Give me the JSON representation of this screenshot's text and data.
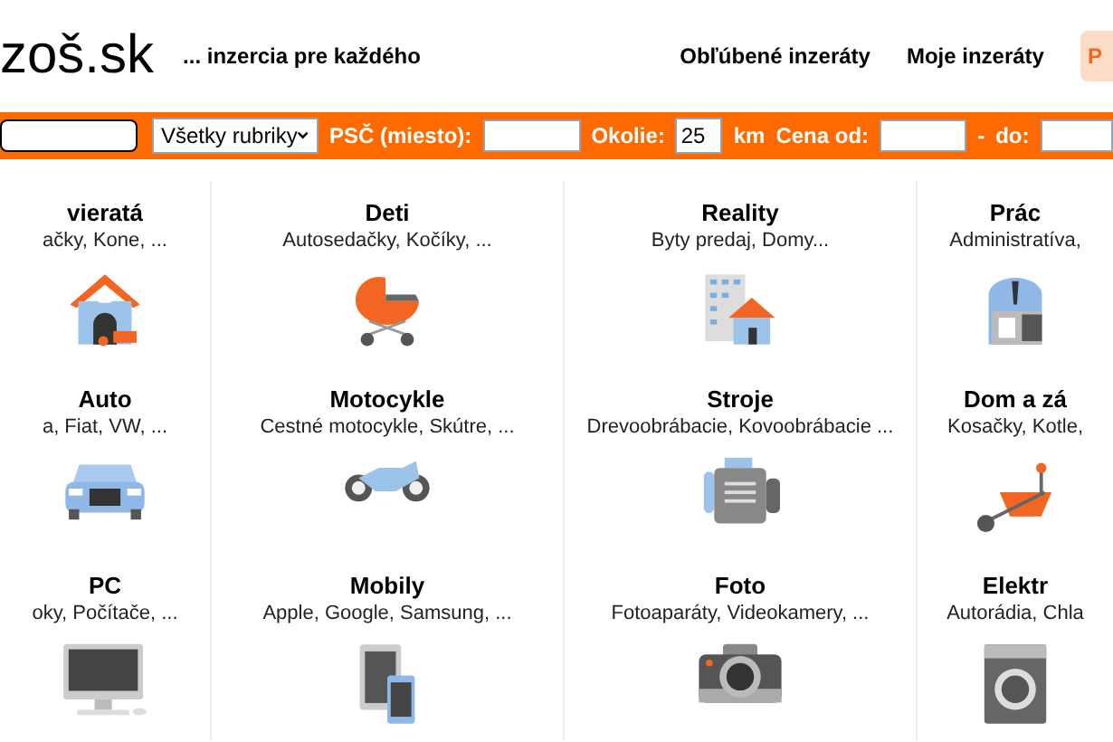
{
  "header": {
    "logo": "zoš.sk",
    "tagline": "... inzercia pre každého",
    "links": [
      "Obľúbené inzeráty",
      "Moje inzeráty"
    ],
    "button": "P"
  },
  "search_bar": {
    "category_select": "Všetky rubriky",
    "zip_label": "PSČ (miesto):",
    "radius_label": "Okolie:",
    "radius_value": "25",
    "radius_unit": "km",
    "price_from_label": "Cena od:",
    "price_separator": "-",
    "price_to_label": "do:"
  },
  "categories": [
    {
      "title": "vieratá",
      "subtitle": "ačky, Kone, ...",
      "kind": "doghouse"
    },
    {
      "title": "Deti",
      "subtitle": "Autosedačky, Kočíky, ...",
      "kind": "stroller"
    },
    {
      "title": "Reality",
      "subtitle": "Byty predaj, Domy...",
      "kind": "buildings"
    },
    {
      "title": "Prác",
      "subtitle": "Administratíva,",
      "kind": "worker"
    },
    {
      "title": "Auto",
      "subtitle": "a, Fiat, VW, ...",
      "kind": "car"
    },
    {
      "title": "Motocykle",
      "subtitle": "Cestné motocykle, Skútre, ...",
      "kind": "motorcycle"
    },
    {
      "title": "Stroje",
      "subtitle": "Drevoobrábacie, Kovoobrábacie ...",
      "kind": "engine"
    },
    {
      "title": "Dom a zá",
      "subtitle": "Kosačky, Kotle,",
      "kind": "wheelbarrow"
    },
    {
      "title": "PC",
      "subtitle": "oky, Počítače, ...",
      "kind": "computer"
    },
    {
      "title": "Mobily",
      "subtitle": "Apple, Google, Samsung, ...",
      "kind": "phones"
    },
    {
      "title": "Foto",
      "subtitle": "Fotoaparáty, Videokamery, ...",
      "kind": "camera"
    },
    {
      "title": "Elektr",
      "subtitle": "Autorádia, Chla",
      "kind": "washer"
    }
  ]
}
